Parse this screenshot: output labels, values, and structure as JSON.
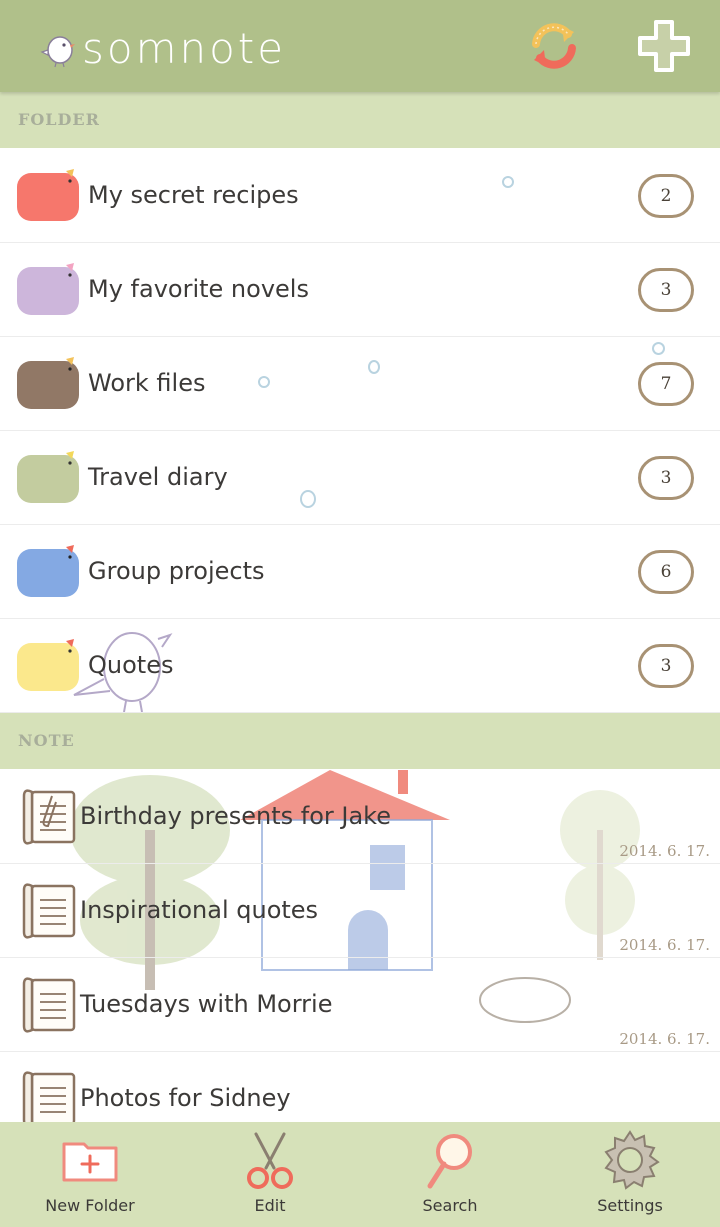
{
  "app": {
    "title": "somnote"
  },
  "header": {
    "sync_icon": "sync-icon",
    "add_icon": "plus-icon"
  },
  "folders_section": {
    "label": "FOLDER"
  },
  "folders": [
    {
      "name": "My secret recipes",
      "count": "2",
      "color": "#f6776c"
    },
    {
      "name": "My favorite novels",
      "count": "3",
      "color": "#cdb6db"
    },
    {
      "name": "Work files",
      "count": "7",
      "color": "#917866"
    },
    {
      "name": "Travel diary",
      "count": "3",
      "color": "#c3cc9f"
    },
    {
      "name": "Group projects",
      "count": "6",
      "color": "#84a9e3"
    },
    {
      "name": "Quotes",
      "count": "3",
      "color": "#fbe88c"
    }
  ],
  "notes_section": {
    "label": "NOTE"
  },
  "notes": [
    {
      "title": "Birthday presents for Jake",
      "date": "2014. 6. 17.",
      "icon": "note-clip-icon"
    },
    {
      "title": "Inspirational quotes",
      "date": "2014. 6. 17.",
      "icon": "note-icon"
    },
    {
      "title": "Tuesdays with Morrie",
      "date": "2014. 6. 17.",
      "icon": "note-icon"
    },
    {
      "title": "Photos for Sidney",
      "date": "",
      "icon": "note-icon"
    }
  ],
  "bottom_bar": {
    "new_folder": "New Folder",
    "edit": "Edit",
    "search": "Search",
    "settings": "Settings"
  },
  "colors": {
    "header": "#b0c08a",
    "section": "#d6e1b9",
    "count_border": "#a89274"
  }
}
